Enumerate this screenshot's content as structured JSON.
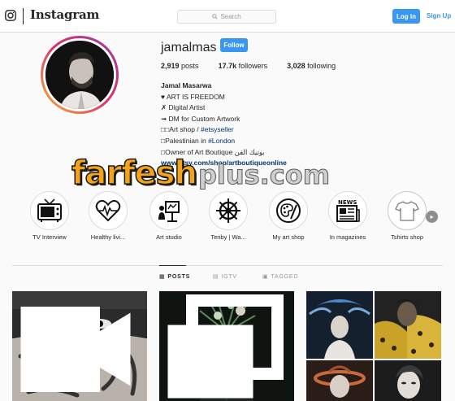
{
  "header": {
    "logo_icon": "instagram-glyph-icon",
    "logo_text": "Instagram",
    "search_placeholder": "Search",
    "login_label": "Log In",
    "signup_label": "Sign Up"
  },
  "profile": {
    "username": "jamalmas",
    "follow_label": "Follow",
    "stats": {
      "posts_count": "2,919",
      "posts_label": "posts",
      "followers_count": "17.7k",
      "followers_label": "followers",
      "following_count": "3,028",
      "following_label": "following"
    },
    "bio": {
      "name": "Jamal Masarwa",
      "line1": "♥ ART IS FREEDOM",
      "line2": "✗ Digital Artist",
      "line3": "➟ DM for Custom Artwork",
      "line4_prefix": "□□Art shop / ",
      "line4_tag": "#etsyseller",
      "line5_prefix": "□Palestinian in ",
      "line5_tag": "#London",
      "line6": "□Owner of Art Boutique بوتيك الفن",
      "link": "www.etsy.com/shop/artboutiqueonline"
    }
  },
  "watermark": {
    "main": "farfesh",
    "plus": "plus.com"
  },
  "highlights": [
    {
      "label": "TV Interview",
      "icon": "tv-icon"
    },
    {
      "label": "Healthy livi...",
      "icon": "heart-pulse-icon"
    },
    {
      "label": "Art studio",
      "icon": "easel-icon"
    },
    {
      "label": "Tenby | Wa...",
      "icon": "ship-wheel-icon"
    },
    {
      "label": "My art shop",
      "icon": "palette-icon"
    },
    {
      "label": "In magazines",
      "icon": "newspaper-icon"
    },
    {
      "label": "Tshirts shop",
      "icon": "tshirt-icon"
    }
  ],
  "highlights_next_icon": "chevron-right-icon",
  "tabs": {
    "posts": "POSTS",
    "igtv": "IGTV",
    "tagged": "TAGGED"
  },
  "colors": {
    "accent": "#3897f0",
    "link": "#003569",
    "border": "#dbdbdb",
    "watermark_orange": "#f4a21a"
  }
}
